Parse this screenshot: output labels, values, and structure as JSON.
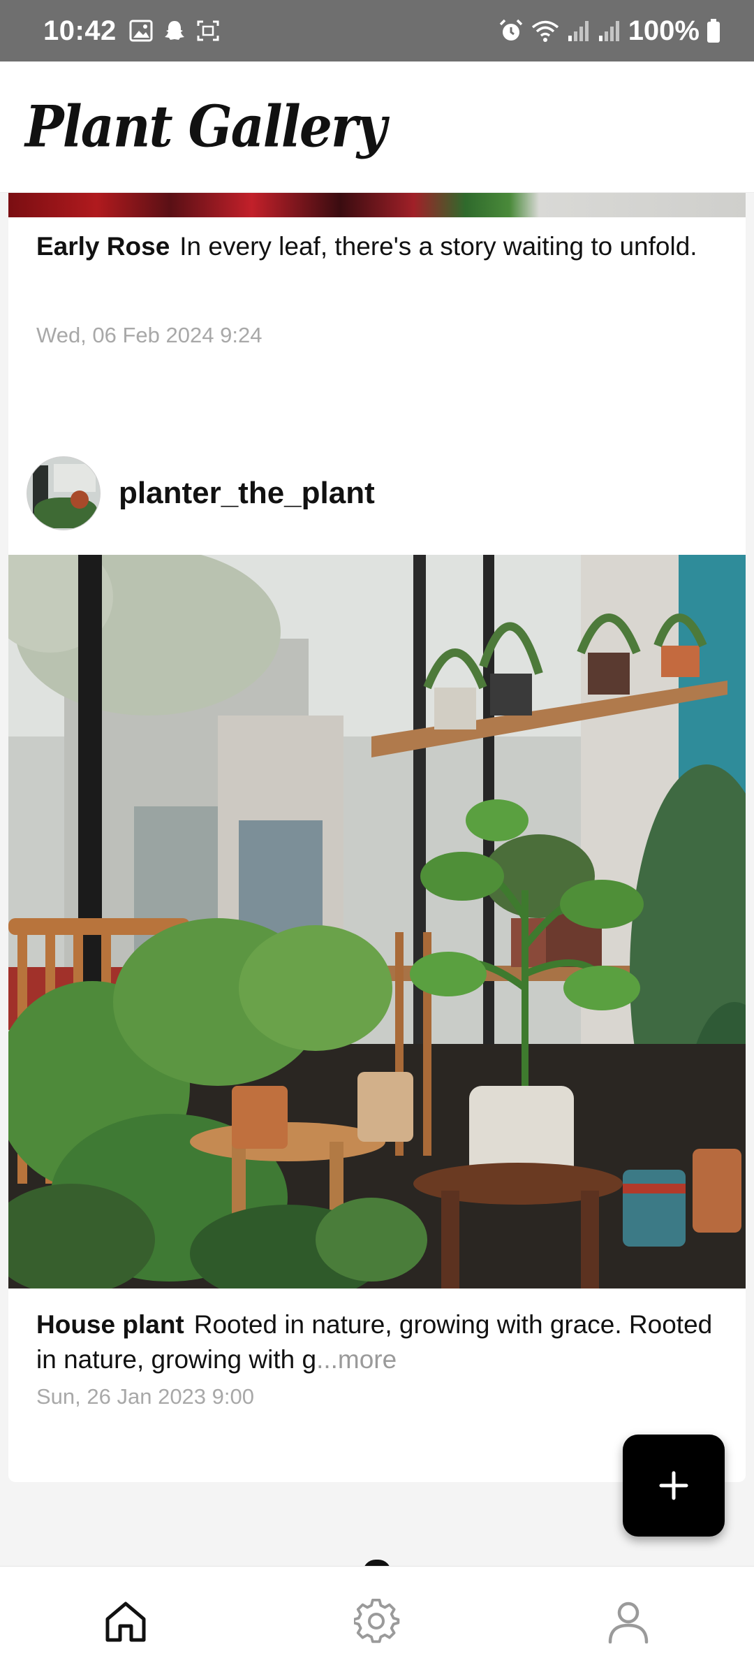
{
  "status_bar": {
    "time": "10:42",
    "battery": "100%",
    "left_icons": [
      "gallery-icon",
      "snapchat-icon",
      "screenshot-icon"
    ],
    "right_icons": [
      "alarm-icon",
      "wifi-icon",
      "signal-icon",
      "signal-icon",
      "battery-icon"
    ]
  },
  "header": {
    "title": "Plant Gallery"
  },
  "posts": [
    {
      "title": "Early Rose",
      "caption": "In every leaf, there's a story waiting to unfold.",
      "date": "Wed, 06 Feb 2024 9:24"
    },
    {
      "username": "planter_the_plant",
      "title": "House plant",
      "caption": "Rooted in nature, growing with grace. Rooted in nature, growing with g",
      "more": "...more",
      "date": "Sun, 26 Jan 2023 9:00"
    }
  ],
  "fab": {
    "icon": "plus-icon"
  },
  "bottom_nav": {
    "items": [
      {
        "icon": "home-icon",
        "active": true
      },
      {
        "icon": "gear-icon",
        "active": false
      },
      {
        "icon": "user-icon",
        "active": false
      }
    ]
  },
  "colors": {
    "status_bar": "#6f6f6f",
    "fab": "#000000",
    "active_icon": "#111111",
    "inactive_icon": "#9a9a9a",
    "date_text": "#a8a8a8"
  }
}
